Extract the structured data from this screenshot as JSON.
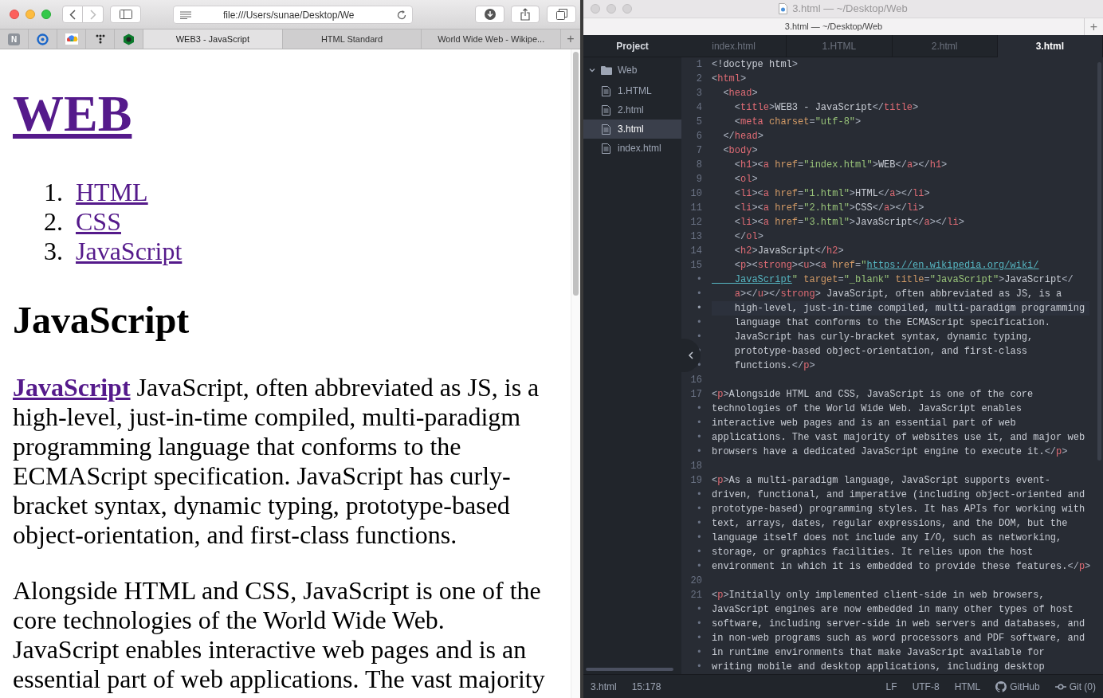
{
  "browser": {
    "url": "file:///Users/sunae/Desktop/We",
    "pinned_tabs": [
      {
        "kind": "letter",
        "label": "N"
      },
      {
        "kind": "ring"
      },
      {
        "kind": "cloud"
      },
      {
        "kind": "dots"
      },
      {
        "kind": "hexagon"
      }
    ],
    "tabs": [
      {
        "label": "WEB3 - JavaScript",
        "selected": true
      },
      {
        "label": "HTML Standard",
        "selected": false
      },
      {
        "label": "World Wide Web - Wikipe...",
        "selected": false
      }
    ],
    "new_tab": "+",
    "page": {
      "heading": "WEB",
      "list": [
        {
          "number": "1.",
          "label": "HTML"
        },
        {
          "number": "2.",
          "label": "CSS"
        },
        {
          "number": "3.",
          "label": "JavaScript"
        }
      ],
      "subheading": "JavaScript",
      "paragraphs": [
        {
          "link": "JavaScript",
          "text": " JavaScript, often abbreviated as JS, is a high-level, just-in-time compiled, multi-paradigm programming language that conforms to the ECMAScript specification. JavaScript has curly-bracket syntax, dynamic typing, prototype-based object-orientation, and first-class functions."
        },
        {
          "text": "Alongside HTML and CSS, JavaScript is one of the core technologies of the World Wide Web. JavaScript enables interactive web pages and is an essential part of web applications. The vast majority"
        }
      ]
    }
  },
  "editor": {
    "window_title": "3.html — ~/Desktop/Web",
    "tab_bar_title": "3.html — ~/Desktop/Web",
    "new_tab": "+",
    "project_title": "Project",
    "tree": [
      {
        "label": "Web",
        "kind": "folder",
        "expanded": true,
        "selected": false,
        "children": [
          {
            "label": "1.HTML",
            "kind": "file",
            "selected": false
          },
          {
            "label": "2.html",
            "kind": "file",
            "selected": false
          },
          {
            "label": "3.html",
            "kind": "file",
            "selected": true
          },
          {
            "label": "index.html",
            "kind": "file",
            "selected": false
          }
        ]
      }
    ],
    "tabs": [
      {
        "label": "index.html",
        "selected": false
      },
      {
        "label": "1.HTML",
        "selected": false
      },
      {
        "label": "2.html",
        "selected": false
      },
      {
        "label": "3.html",
        "selected": true
      }
    ],
    "lines": [
      {
        "gutter": "1",
        "current": false,
        "tokens": [
          {
            "kind": "punct",
            "text": "<"
          },
          {
            "kind": "text",
            "text": "!doctype html"
          },
          {
            "kind": "punct",
            "text": ">"
          }
        ]
      },
      {
        "gutter": "2",
        "current": false,
        "tokens": [
          {
            "kind": "punct",
            "text": "<"
          },
          {
            "kind": "tag",
            "text": "html"
          },
          {
            "kind": "punct",
            "text": ">"
          }
        ]
      },
      {
        "gutter": "3",
        "current": false,
        "tokens": [
          {
            "kind": "punct",
            "text": "  <"
          },
          {
            "kind": "tag",
            "text": "head"
          },
          {
            "kind": "punct",
            "text": ">"
          }
        ]
      },
      {
        "gutter": "4",
        "current": false,
        "tokens": [
          {
            "kind": "punct",
            "text": "    <"
          },
          {
            "kind": "tag",
            "text": "title"
          },
          {
            "kind": "punct",
            "text": ">"
          },
          {
            "kind": "text",
            "text": "WEB3 - JavaScript"
          },
          {
            "kind": "punct",
            "text": "</"
          },
          {
            "kind": "tag",
            "text": "title"
          },
          {
            "kind": "punct",
            "text": ">"
          }
        ]
      },
      {
        "gutter": "5",
        "current": false,
        "tokens": [
          {
            "kind": "punct",
            "text": "    <"
          },
          {
            "kind": "tag",
            "text": "meta"
          },
          {
            "kind": "attr",
            "text": " charset"
          },
          {
            "kind": "punct",
            "text": "="
          },
          {
            "kind": "string",
            "text": "\"utf-8\""
          },
          {
            "kind": "punct",
            "text": ">"
          }
        ]
      },
      {
        "gutter": "6",
        "current": false,
        "tokens": [
          {
            "kind": "punct",
            "text": "  </"
          },
          {
            "kind": "tag",
            "text": "head"
          },
          {
            "kind": "punct",
            "text": ">"
          }
        ]
      },
      {
        "gutter": "7",
        "current": false,
        "tokens": [
          {
            "kind": "punct",
            "text": "  <"
          },
          {
            "kind": "tag",
            "text": "body"
          },
          {
            "kind": "punct",
            "text": ">"
          }
        ]
      },
      {
        "gutter": "8",
        "current": false,
        "tokens": [
          {
            "kind": "punct",
            "text": "    <"
          },
          {
            "kind": "tag",
            "text": "h1"
          },
          {
            "kind": "punct",
            "text": "><"
          },
          {
            "kind": "tag",
            "text": "a"
          },
          {
            "kind": "attr",
            "text": " href"
          },
          {
            "kind": "punct",
            "text": "="
          },
          {
            "kind": "string",
            "text": "\"index.html\""
          },
          {
            "kind": "punct",
            "text": ">"
          },
          {
            "kind": "text",
            "text": "WEB"
          },
          {
            "kind": "punct",
            "text": "</"
          },
          {
            "kind": "tag",
            "text": "a"
          },
          {
            "kind": "punct",
            "text": "></"
          },
          {
            "kind": "tag",
            "text": "h1"
          },
          {
            "kind": "punct",
            "text": ">"
          }
        ]
      },
      {
        "gutter": "9",
        "current": false,
        "tokens": [
          {
            "kind": "punct",
            "text": "    <"
          },
          {
            "kind": "tag",
            "text": "ol"
          },
          {
            "kind": "punct",
            "text": ">"
          }
        ]
      },
      {
        "gutter": "10",
        "current": false,
        "tokens": [
          {
            "kind": "punct",
            "text": "    <"
          },
          {
            "kind": "tag",
            "text": "li"
          },
          {
            "kind": "punct",
            "text": "><"
          },
          {
            "kind": "tag",
            "text": "a"
          },
          {
            "kind": "attr",
            "text": " href"
          },
          {
            "kind": "punct",
            "text": "="
          },
          {
            "kind": "string",
            "text": "\"1.html\""
          },
          {
            "kind": "punct",
            "text": ">"
          },
          {
            "kind": "text",
            "text": "HTML"
          },
          {
            "kind": "punct",
            "text": "</"
          },
          {
            "kind": "tag",
            "text": "a"
          },
          {
            "kind": "punct",
            "text": "></"
          },
          {
            "kind": "tag",
            "text": "li"
          },
          {
            "kind": "punct",
            "text": ">"
          }
        ]
      },
      {
        "gutter": "11",
        "current": false,
        "tokens": [
          {
            "kind": "punct",
            "text": "    <"
          },
          {
            "kind": "tag",
            "text": "li"
          },
          {
            "kind": "punct",
            "text": "><"
          },
          {
            "kind": "tag",
            "text": "a"
          },
          {
            "kind": "attr",
            "text": " href"
          },
          {
            "kind": "punct",
            "text": "="
          },
          {
            "kind": "string",
            "text": "\"2.html\""
          },
          {
            "kind": "punct",
            "text": ">"
          },
          {
            "kind": "text",
            "text": "CSS"
          },
          {
            "kind": "punct",
            "text": "</"
          },
          {
            "kind": "tag",
            "text": "a"
          },
          {
            "kind": "punct",
            "text": "></"
          },
          {
            "kind": "tag",
            "text": "li"
          },
          {
            "kind": "punct",
            "text": ">"
          }
        ]
      },
      {
        "gutter": "12",
        "current": false,
        "tokens": [
          {
            "kind": "punct",
            "text": "    <"
          },
          {
            "kind": "tag",
            "text": "li"
          },
          {
            "kind": "punct",
            "text": "><"
          },
          {
            "kind": "tag",
            "text": "a"
          },
          {
            "kind": "attr",
            "text": " href"
          },
          {
            "kind": "punct",
            "text": "="
          },
          {
            "kind": "string",
            "text": "\"3.html\""
          },
          {
            "kind": "punct",
            "text": ">"
          },
          {
            "kind": "text",
            "text": "JavaScript"
          },
          {
            "kind": "punct",
            "text": "</"
          },
          {
            "kind": "tag",
            "text": "a"
          },
          {
            "kind": "punct",
            "text": "></"
          },
          {
            "kind": "tag",
            "text": "li"
          },
          {
            "kind": "punct",
            "text": ">"
          }
        ]
      },
      {
        "gutter": "13",
        "current": false,
        "tokens": [
          {
            "kind": "punct",
            "text": "    </"
          },
          {
            "kind": "tag",
            "text": "ol"
          },
          {
            "kind": "punct",
            "text": ">"
          }
        ]
      },
      {
        "gutter": "14",
        "current": false,
        "tokens": [
          {
            "kind": "punct",
            "text": "    <"
          },
          {
            "kind": "tag",
            "text": "h2"
          },
          {
            "kind": "punct",
            "text": ">"
          },
          {
            "kind": "text",
            "text": "JavaScript"
          },
          {
            "kind": "punct",
            "text": "</"
          },
          {
            "kind": "tag",
            "text": "h2"
          },
          {
            "kind": "punct",
            "text": ">"
          }
        ]
      },
      {
        "gutter": "15",
        "current": false,
        "tokens": [
          {
            "kind": "punct",
            "text": "    <"
          },
          {
            "kind": "tag",
            "text": "p"
          },
          {
            "kind": "punct",
            "text": "><"
          },
          {
            "kind": "tag",
            "text": "strong"
          },
          {
            "kind": "punct",
            "text": "><"
          },
          {
            "kind": "tag",
            "text": "u"
          },
          {
            "kind": "punct",
            "text": "><"
          },
          {
            "kind": "tag",
            "text": "a"
          },
          {
            "kind": "attr",
            "text": " href"
          },
          {
            "kind": "punct",
            "text": "="
          },
          {
            "kind": "string",
            "text": "\""
          },
          {
            "kind": "link",
            "text": "https://en.wikipedia.org/wiki/"
          }
        ]
      },
      {
        "gutter": "•",
        "current": false,
        "tokens": [
          {
            "kind": "link",
            "text": "    JavaScript"
          },
          {
            "kind": "string",
            "text": "\""
          },
          {
            "kind": "attr",
            "text": " target"
          },
          {
            "kind": "punct",
            "text": "="
          },
          {
            "kind": "string",
            "text": "\"_blank\""
          },
          {
            "kind": "attr",
            "text": " title"
          },
          {
            "kind": "punct",
            "text": "="
          },
          {
            "kind": "string",
            "text": "\"JavaScript\""
          },
          {
            "kind": "punct",
            "text": ">"
          },
          {
            "kind": "text",
            "text": "JavaScript"
          },
          {
            "kind": "punct",
            "text": "</"
          }
        ]
      },
      {
        "gutter": "•",
        "current": false,
        "tokens": [
          {
            "kind": "tag",
            "text": "    a"
          },
          {
            "kind": "punct",
            "text": "></"
          },
          {
            "kind": "tag",
            "text": "u"
          },
          {
            "kind": "punct",
            "text": "></"
          },
          {
            "kind": "tag",
            "text": "strong"
          },
          {
            "kind": "punct",
            "text": ">"
          },
          {
            "kind": "text",
            "text": " JavaScript, often abbreviated as JS, is a"
          }
        ]
      },
      {
        "gutter": "•",
        "current": true,
        "tokens": [
          {
            "kind": "text",
            "text": "    high-level, just-in-time compiled, multi-paradigm programming"
          }
        ]
      },
      {
        "gutter": "•",
        "current": false,
        "tokens": [
          {
            "kind": "text",
            "text": "    language that conforms to the ECMAScript specification."
          }
        ]
      },
      {
        "gutter": "•",
        "current": false,
        "tokens": [
          {
            "kind": "text",
            "text": "    JavaScript has curly-bracket syntax, dynamic typing,"
          }
        ]
      },
      {
        "gutter": "•",
        "current": false,
        "tokens": [
          {
            "kind": "text",
            "text": "    prototype-based object-orientation, and first-class"
          }
        ]
      },
      {
        "gutter": "•",
        "current": false,
        "tokens": [
          {
            "kind": "text",
            "text": "    functions."
          },
          {
            "kind": "punct",
            "text": "</"
          },
          {
            "kind": "tag",
            "text": "p"
          },
          {
            "kind": "punct",
            "text": ">"
          }
        ]
      },
      {
        "gutter": "16",
        "current": false
      },
      {
        "gutter": "17",
        "current": false,
        "tokens": [
          {
            "kind": "punct",
            "text": "<"
          },
          {
            "kind": "tag",
            "text": "p"
          },
          {
            "kind": "punct",
            "text": ">"
          },
          {
            "kind": "text",
            "text": "Alongside HTML and CSS, JavaScript is one of the core"
          }
        ]
      },
      {
        "gutter": "•",
        "current": false,
        "tokens": [
          {
            "kind": "text",
            "text": "technologies of the World Wide Web. JavaScript enables"
          }
        ]
      },
      {
        "gutter": "•",
        "current": false,
        "tokens": [
          {
            "kind": "text",
            "text": "interactive web pages and is an essential part of web"
          }
        ]
      },
      {
        "gutter": "•",
        "current": false,
        "tokens": [
          {
            "kind": "text",
            "text": "applications. The vast majority of websites use it, and major web"
          }
        ]
      },
      {
        "gutter": "•",
        "current": false,
        "tokens": [
          {
            "kind": "text",
            "text": "browsers have a dedicated JavaScript engine to execute it."
          },
          {
            "kind": "punct",
            "text": "</"
          },
          {
            "kind": "tag",
            "text": "p"
          },
          {
            "kind": "punct",
            "text": ">"
          }
        ]
      },
      {
        "gutter": "18",
        "current": false
      },
      {
        "gutter": "19",
        "current": false,
        "tokens": [
          {
            "kind": "punct",
            "text": "<"
          },
          {
            "kind": "tag",
            "text": "p"
          },
          {
            "kind": "punct",
            "text": ">"
          },
          {
            "kind": "text",
            "text": "As a multi-paradigm language, JavaScript supports event-"
          }
        ]
      },
      {
        "gutter": "•",
        "current": false,
        "tokens": [
          {
            "kind": "text",
            "text": "driven, functional, and imperative (including object-oriented and"
          }
        ]
      },
      {
        "gutter": "•",
        "current": false,
        "tokens": [
          {
            "kind": "text",
            "text": "prototype-based) programming styles. It has APIs for working with"
          }
        ]
      },
      {
        "gutter": "•",
        "current": false,
        "tokens": [
          {
            "kind": "text",
            "text": "text, arrays, dates, regular expressions, and the DOM, but the"
          }
        ]
      },
      {
        "gutter": "•",
        "current": false,
        "tokens": [
          {
            "kind": "text",
            "text": "language itself does not include any I/O, such as networking,"
          }
        ]
      },
      {
        "gutter": "•",
        "current": false,
        "tokens": [
          {
            "kind": "text",
            "text": "storage, or graphics facilities. It relies upon the host"
          }
        ]
      },
      {
        "gutter": "•",
        "current": false,
        "tokens": [
          {
            "kind": "text",
            "text": "environment in which it is embedded to provide these features."
          },
          {
            "kind": "punct",
            "text": "</"
          },
          {
            "kind": "tag",
            "text": "p"
          },
          {
            "kind": "punct",
            "text": ">"
          }
        ]
      },
      {
        "gutter": "20",
        "current": false
      },
      {
        "gutter": "21",
        "current": false,
        "tokens": [
          {
            "kind": "punct",
            "text": "<"
          },
          {
            "kind": "tag",
            "text": "p"
          },
          {
            "kind": "punct",
            "text": ">"
          },
          {
            "kind": "text",
            "text": "Initially only implemented client-side in web browsers,"
          }
        ]
      },
      {
        "gutter": "•",
        "current": false,
        "tokens": [
          {
            "kind": "text",
            "text": "JavaScript engines are now embedded in many other types of host"
          }
        ]
      },
      {
        "gutter": "•",
        "current": false,
        "tokens": [
          {
            "kind": "text",
            "text": "software, including server-side in web servers and databases, and"
          }
        ]
      },
      {
        "gutter": "•",
        "current": false,
        "tokens": [
          {
            "kind": "text",
            "text": "in non-web programs such as word processors and PDF software, and"
          }
        ]
      },
      {
        "gutter": "•",
        "current": false,
        "tokens": [
          {
            "kind": "text",
            "text": "in runtime environments that make JavaScript available for"
          }
        ]
      },
      {
        "gutter": "•",
        "current": false,
        "tokens": [
          {
            "kind": "text",
            "text": "writing mobile and desktop applications, including desktop"
          }
        ]
      }
    ],
    "status_left": [
      "3.html",
      "15:178"
    ],
    "status_right": [
      {
        "kind": "plain",
        "text": "LF"
      },
      {
        "kind": "plain",
        "text": "UTF-8"
      },
      {
        "kind": "plain",
        "text": "HTML"
      },
      {
        "kind": "github",
        "text": "GitHub"
      },
      {
        "kind": "git",
        "text": "Git (0)"
      }
    ]
  }
}
